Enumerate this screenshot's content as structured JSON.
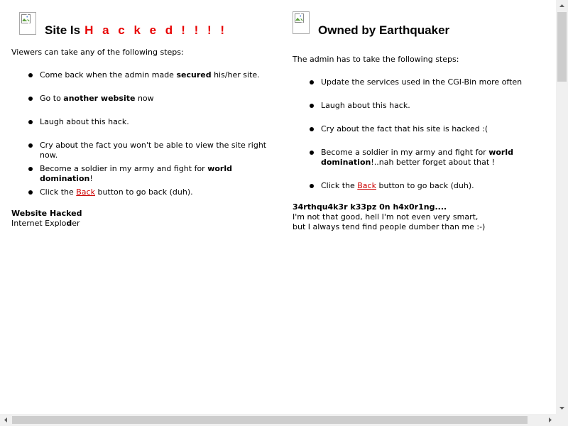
{
  "left": {
    "title_prefix": "Site Is",
    "title_hacked": "H a c k e d",
    "title_bangs": "! ! ! !",
    "intro": "Viewers can take any of the following steps:",
    "steps": [
      {
        "a": "Come back when the admin made ",
        "b": "secured",
        "c": " his/her site."
      },
      {
        "a": "Go to ",
        "b": "another website",
        "c": " now"
      },
      {
        "a": "Laugh about this hack.",
        "b": "",
        "c": ""
      },
      {
        "a": "Cry about the fact you won't be able to view the site right now.",
        "b": "",
        "c": ""
      },
      {
        "a": "Become a soldier in my army and fight for ",
        "b": "world domination",
        "c": "!"
      },
      {
        "a": "Click the ",
        "link": "Back",
        "c": " button to go back (duh)."
      }
    ],
    "sig_bold": "Website Hacked",
    "sig_line": "Internet Explo",
    "sig_bold_char": "d",
    "sig_line_end": "er"
  },
  "right": {
    "title": "Owned by Earthquaker",
    "intro": "The admin has to take the following steps:",
    "steps": [
      {
        "a": "Update the services used in the CGI-Bin more often",
        "b": "",
        "c": ""
      },
      {
        "a": "Laugh about this hack.",
        "b": "",
        "c": ""
      },
      {
        "a": "Cry about the fact that his site is hacked :(",
        "b": "",
        "c": ""
      },
      {
        "a": "Become a soldier in my army and fight for ",
        "b": "world domination",
        "c": "!..nah better forget about that !"
      },
      {
        "a": "Click the ",
        "link": "Back",
        "c": " button to go back (duh)."
      }
    ],
    "sig_bold": "34rthqu4k3r k33pz 0n h4x0r1ng....",
    "sig_line1": "I'm not that good, hell I'm not even very smart,",
    "sig_line2": "but I always tend find people dumber than me :-)"
  },
  "colors": {
    "hacked": "#e80000",
    "link": "#cc0000",
    "scrollbar_track": "#f0f0f0",
    "scrollbar_thumb": "#cdcdcd"
  },
  "icons": {
    "broken_image": "broken-image-icon",
    "scroll_up": "arrow-up-icon",
    "scroll_down": "arrow-down-icon",
    "scroll_left": "arrow-left-icon",
    "scroll_right": "arrow-right-icon"
  }
}
